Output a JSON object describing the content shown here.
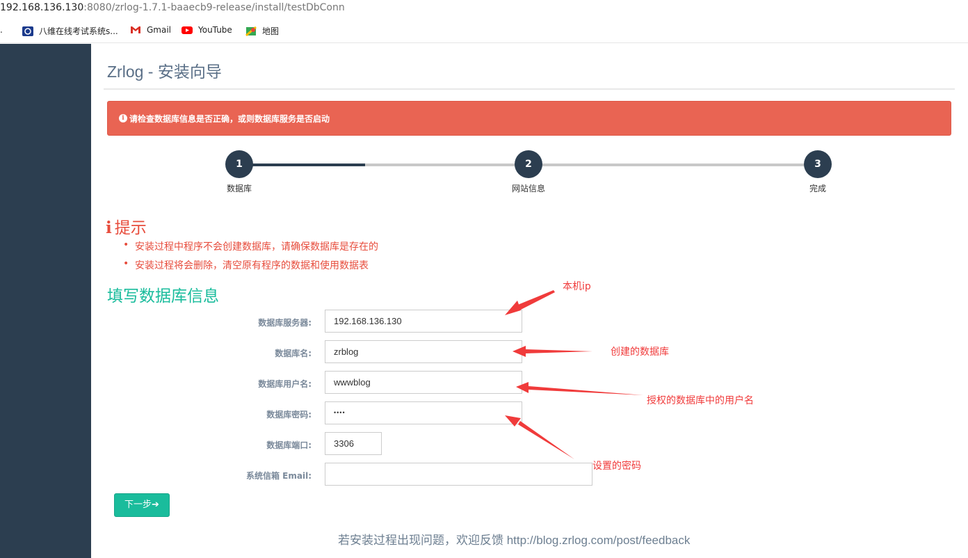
{
  "browser": {
    "url_host": "192.168.136.130",
    "url_path": ":8080/zrlog-1.7.1-baaecb9-release/install/testDbConn",
    "bookmarks": [
      {
        "label": "八维在线考试系统s...",
        "icon": "exam-site-icon"
      },
      {
        "label": "Gmail",
        "icon": "gmail-icon",
        "color": "#d93025"
      },
      {
        "label": "YouTube",
        "icon": "youtube-icon",
        "color": "#ff0000"
      },
      {
        "label": "地图",
        "icon": "maps-icon"
      }
    ]
  },
  "page": {
    "title": "Zrlog - 安装向导",
    "alert": "请检查数据库信息是否正确，或则数据库服务是否启动",
    "steps": [
      {
        "number": "1",
        "label": "数据库"
      },
      {
        "number": "2",
        "label": "网站信息"
      },
      {
        "number": "3",
        "label": "完成"
      }
    ],
    "tips_heading": "提示",
    "tips": [
      "安装过程中程序不会创建数据库，请确保数据库是存在的",
      "安装过程将会删除，清空原有程序的数据和使用数据表"
    ],
    "form_heading": "填写数据库信息",
    "form": {
      "server_label": "数据库服务器:",
      "server_value": "192.168.136.130",
      "dbname_label": "数据库名:",
      "dbname_value": "zrblog",
      "user_label": "数据库用户名:",
      "user_value": "wwwblog",
      "password_label": "数据库密码:",
      "password_value": "••••",
      "port_label": "数据库端口:",
      "port_value": "3306",
      "email_label": "系统信箱 Email:",
      "email_value": ""
    },
    "next_button": "下一步➔",
    "footer": "若安装过程出现问题，欢迎反馈 http://blog.zrlog.com/post/feedback"
  },
  "annotations": [
    {
      "text": "本机ip"
    },
    {
      "text": "创建的数据库"
    },
    {
      "text": "授权的数据库中的用户名"
    },
    {
      "text": "设置的密码"
    }
  ],
  "colors": {
    "sidebar": "#2c3e50",
    "alert": "#e96453",
    "tips": "#e74c3c",
    "heading_green": "#1abc9c",
    "annotation_red": "#f03b3b"
  }
}
